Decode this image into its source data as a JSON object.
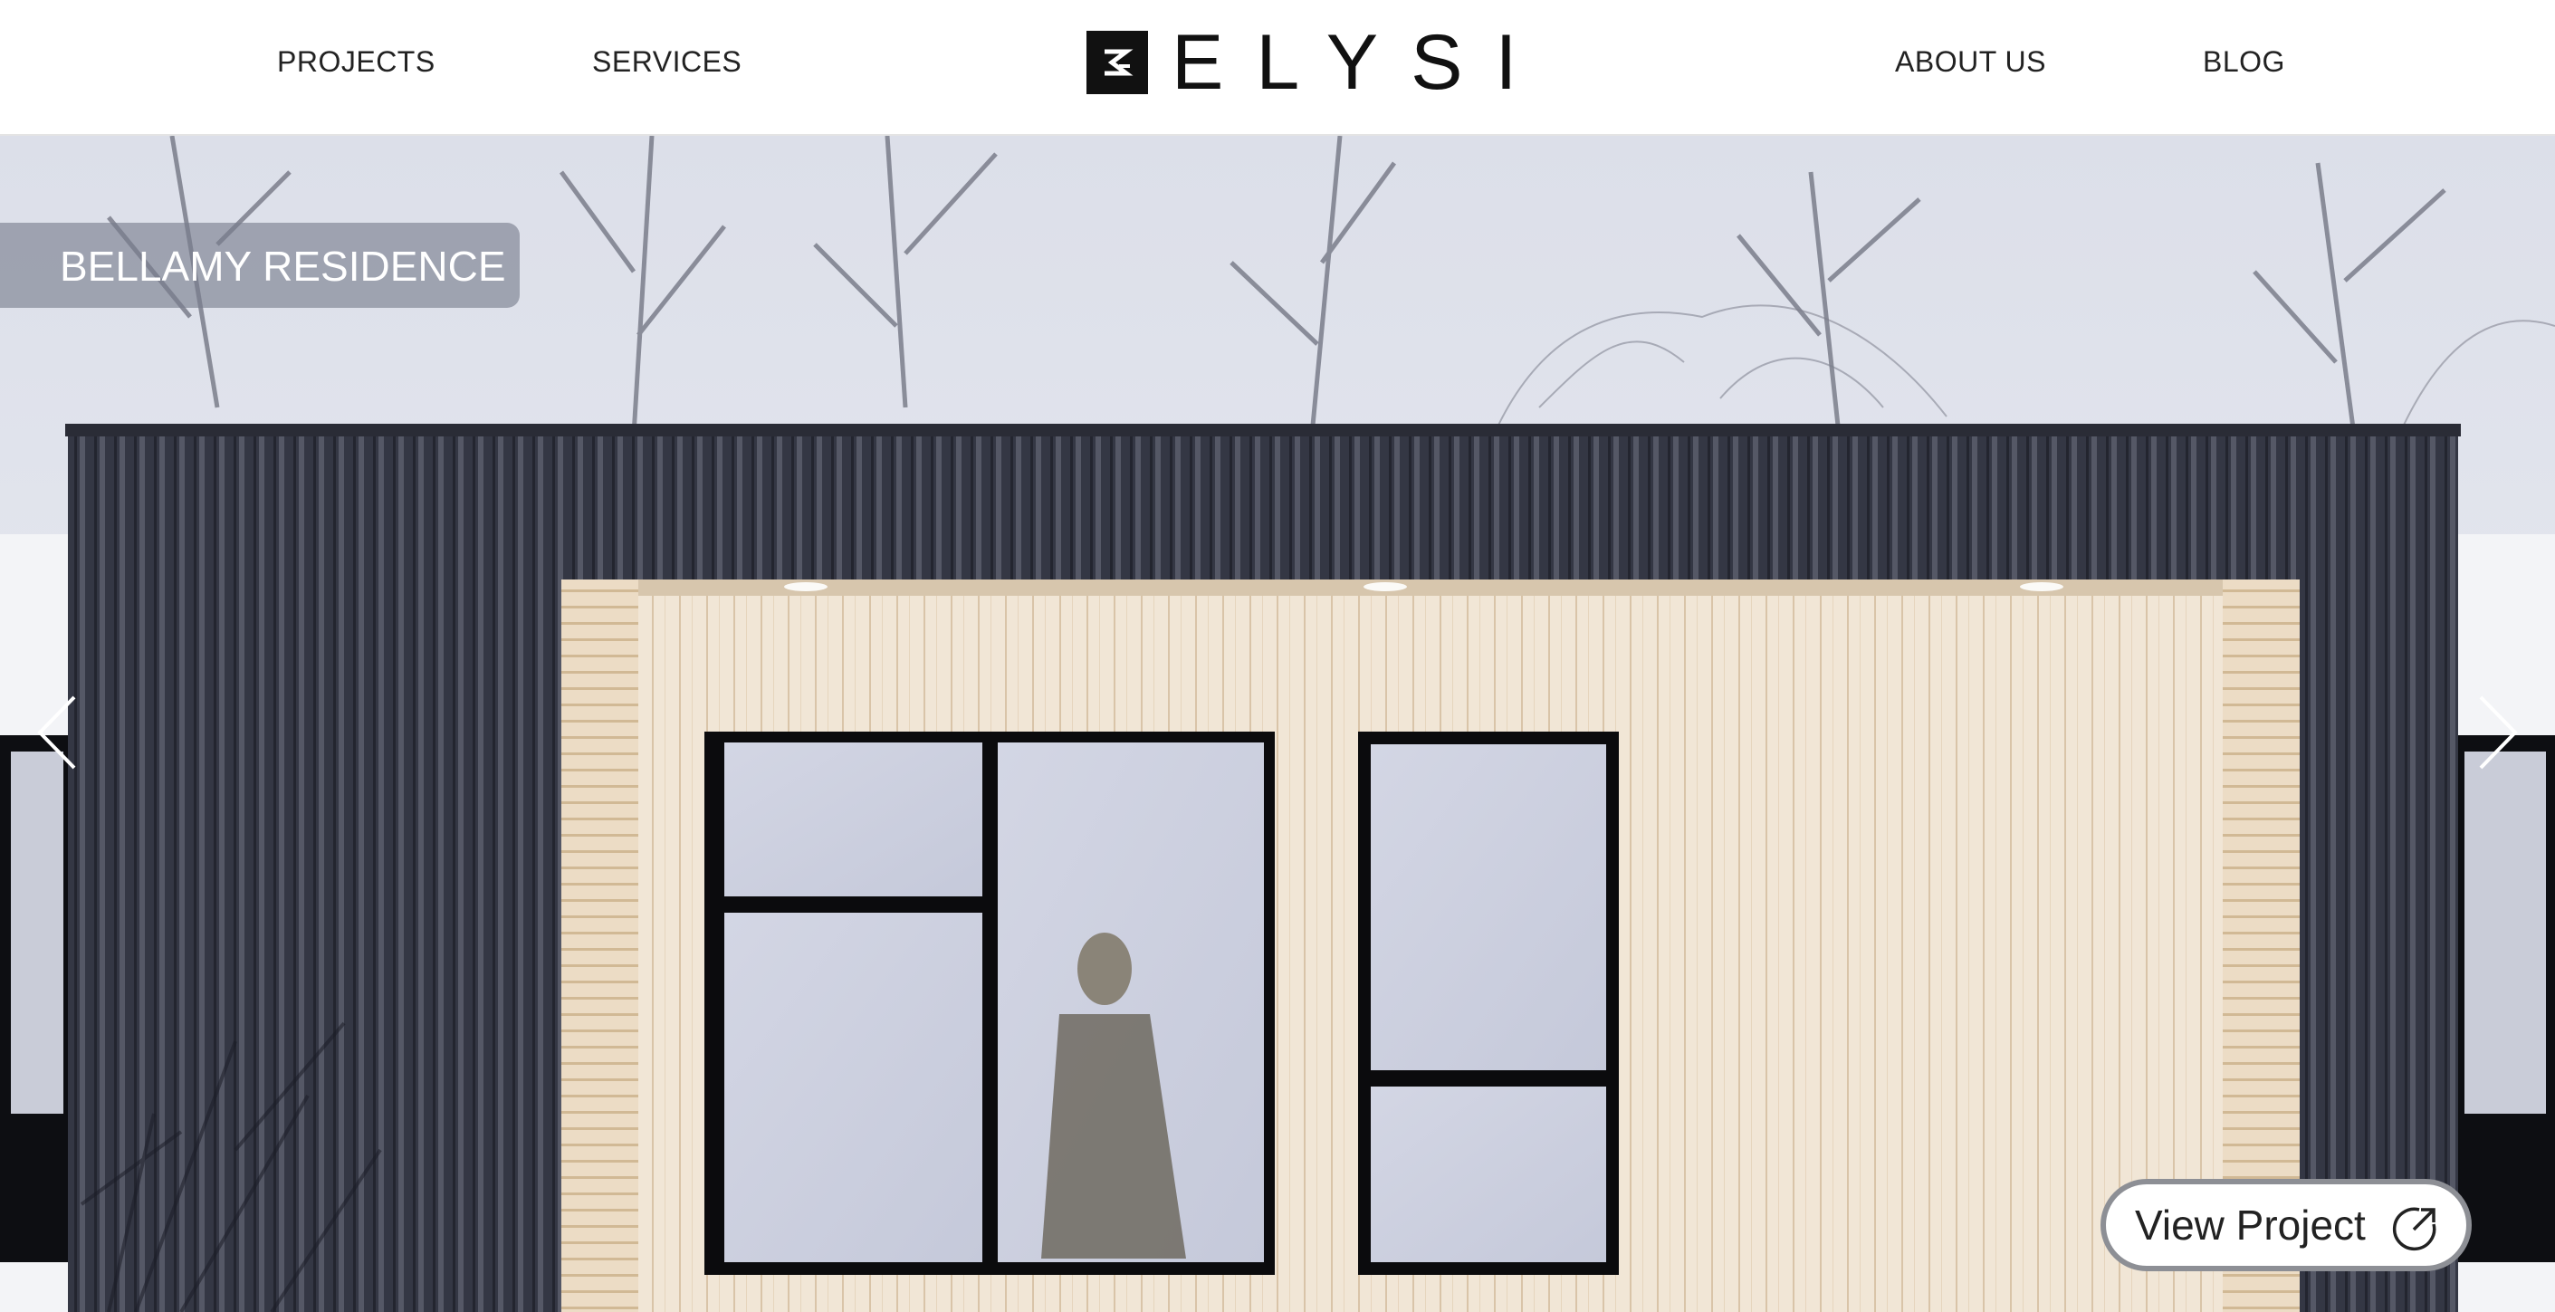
{
  "nav": {
    "left": [
      "PROJECTS",
      "SERVICES"
    ],
    "right": [
      "ABOUT US",
      "BLOG"
    ]
  },
  "brand": {
    "name": "ELYSI",
    "logo_icon": "elysi-monogram-icon"
  },
  "hero": {
    "project_title": "BELLAMY RESIDENCE",
    "cta_label": "View Project",
    "cta_icon": "external-link-icon",
    "prev_icon": "chevron-left-icon",
    "next_icon": "chevron-right-icon"
  },
  "colors": {
    "header_bg": "#ffffff",
    "text": "#222222",
    "badge_bg": "rgba(120,125,140,0.62)",
    "cladding_dark": "#2f3240",
    "cladding_light": "#efe3d2",
    "button_border": "#8d8f95"
  }
}
